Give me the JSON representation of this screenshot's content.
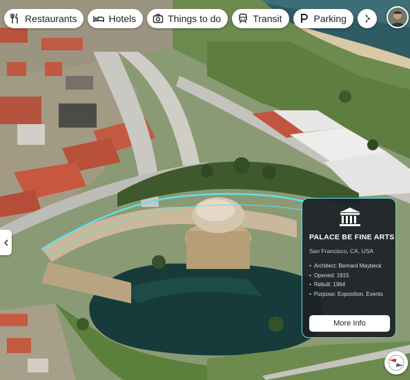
{
  "chips": [
    {
      "label": "Restaurants",
      "icon": "fork-knife-icon"
    },
    {
      "label": "Hotels",
      "icon": "bed-icon"
    },
    {
      "label": "Things to do",
      "icon": "camera-icon"
    },
    {
      "label": "Transit",
      "icon": "train-icon"
    },
    {
      "label": "Parking",
      "icon": "parking-icon"
    }
  ],
  "more_icon": "chevron-right-icon",
  "apps_icon": "apps-grid-icon",
  "account_icon": "avatar",
  "side_panel_icon": "chevron-left-icon",
  "place_card": {
    "icon": "museum-icon",
    "title": "PALACE BE FINE ARTS",
    "location": "San Francisco, CA, USA",
    "facts": [
      "Architect: Bemard Maybeck",
      "Opened: 1915",
      "Rebult: 1964",
      "Purpose: Exposition, Events"
    ],
    "button": "More Info"
  },
  "compass_icon": "compass-icon",
  "colors": {
    "highlight": "#5fe1ea",
    "card_bg": "#1c2126"
  }
}
